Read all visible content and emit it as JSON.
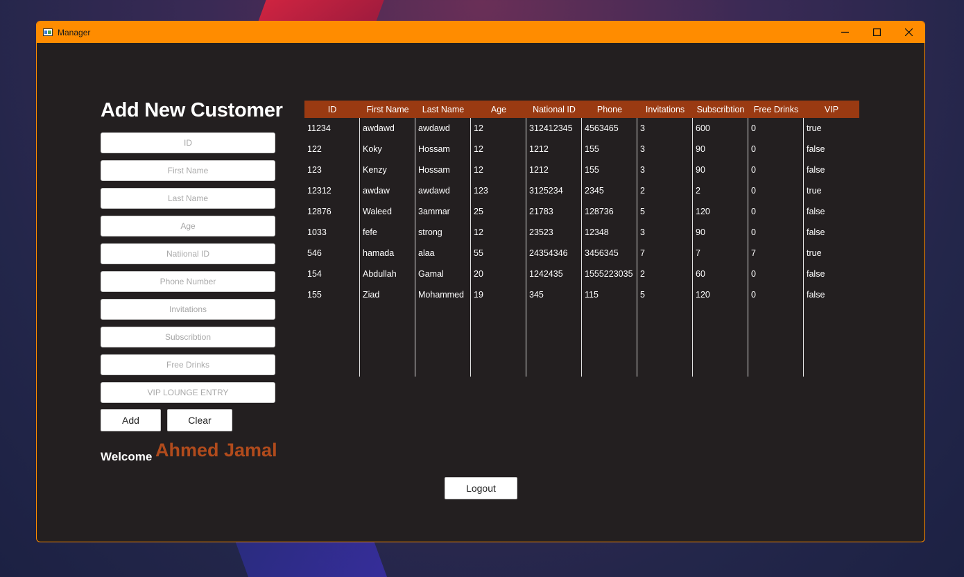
{
  "window": {
    "title": "Manager"
  },
  "form": {
    "heading": "Add New Customer",
    "placeholders": {
      "id": "ID",
      "first_name": "First Name",
      "last_name": "Last Name",
      "age": "Age",
      "national_id": "Natiional ID",
      "phone": "Phone Number",
      "invitations": "Invitations",
      "subscription": "Subscribtion",
      "free_drinks": "Free Drinks",
      "vip": "VIP LOUNGE ENTRY"
    },
    "add_label": "Add",
    "clear_label": "Clear"
  },
  "welcome": {
    "label": "Welcome",
    "user": "Ahmed Jamal"
  },
  "logout_label": "Logout",
  "table": {
    "headers": [
      "ID",
      "First Name",
      "Last Name",
      "Age",
      "National ID",
      "Phone",
      "Invitations",
      "Subscribtion",
      "Free Drinks",
      "VIP"
    ],
    "rows": [
      [
        "11234",
        "awdawd",
        "awdawd",
        "12",
        "312412345",
        "4563465",
        "3",
        "600",
        "0",
        "true"
      ],
      [
        "122",
        "Koky",
        "Hossam",
        "12",
        "1212",
        "155",
        "3",
        "90",
        "0",
        "false"
      ],
      [
        "123",
        "Kenzy",
        "Hossam",
        "12",
        "1212",
        "155",
        "3",
        "90",
        "0",
        "false"
      ],
      [
        "12312",
        "awdaw",
        "awdawd",
        "123",
        "3125234",
        "2345",
        "2",
        "2",
        "0",
        "true"
      ],
      [
        "12876",
        "Waleed",
        "3ammar",
        "25",
        "21783",
        "128736",
        "5",
        "120",
        "0",
        "false"
      ],
      [
        "1033",
        "fefe",
        "strong",
        "12",
        "23523",
        "12348",
        "3",
        "90",
        "0",
        "false"
      ],
      [
        "546",
        "hamada",
        "alaa",
        "55",
        "24354346",
        "3456345",
        "7",
        "7",
        "7",
        "true"
      ],
      [
        "154",
        "Abdullah",
        "Gamal",
        "20",
        "1242435",
        "1555223035",
        "2",
        "60",
        "0",
        "false"
      ],
      [
        "155",
        "Ziad",
        "Mohammed",
        "19",
        "345",
        "115",
        "5",
        "120",
        "0",
        "false"
      ]
    ]
  },
  "colors": {
    "titlebar": "#ff8c00",
    "header": "#9a3a12",
    "accent_name": "#b14b1c",
    "window_bg": "#231f20"
  }
}
